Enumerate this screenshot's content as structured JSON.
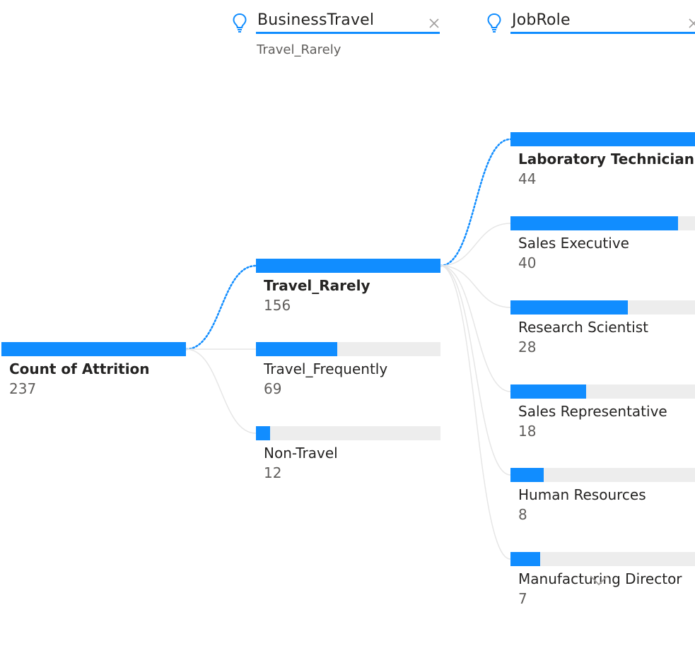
{
  "levels": [
    {
      "title": "BusinessTravel",
      "selected": "Travel_Rarely",
      "icon": "lightbulb-icon",
      "close_icon": "close-icon"
    },
    {
      "title": "JobRole",
      "icon": "lightbulb-icon",
      "close_icon": "close-icon"
    }
  ],
  "root": {
    "label": "Count of Attrition",
    "value": "237",
    "fraction": 1.0
  },
  "business_travel": [
    {
      "label": "Travel_Rarely",
      "value": "156",
      "fraction": 1.0,
      "selected": true
    },
    {
      "label": "Travel_Frequently",
      "value": "69",
      "fraction": 0.4423,
      "selected": false
    },
    {
      "label": "Non-Travel",
      "value": "12",
      "fraction": 0.0769,
      "selected": false
    }
  ],
  "job_role": [
    {
      "label": "Laboratory Technician",
      "value": "44",
      "fraction": 1.0,
      "selected": true
    },
    {
      "label": "Sales Executive",
      "value": "40",
      "fraction": 0.9091,
      "selected": false
    },
    {
      "label": "Research Scientist",
      "value": "28",
      "fraction": 0.6364,
      "selected": false
    },
    {
      "label": "Sales Representative",
      "value": "18",
      "fraction": 0.4091,
      "selected": false
    },
    {
      "label": "Human Resources",
      "value": "8",
      "fraction": 0.1818,
      "selected": false
    },
    {
      "label": "Manufacturing Director",
      "value": "7",
      "fraction": 0.1591,
      "selected": false
    }
  ],
  "colors": {
    "accent": "#118dff",
    "track": "#ededed",
    "connector": "#e6e6e6",
    "text": "#252423",
    "muted": "#605e5c",
    "close": "#a19f9d"
  },
  "scroll_icon": "chevron-down-icon"
}
